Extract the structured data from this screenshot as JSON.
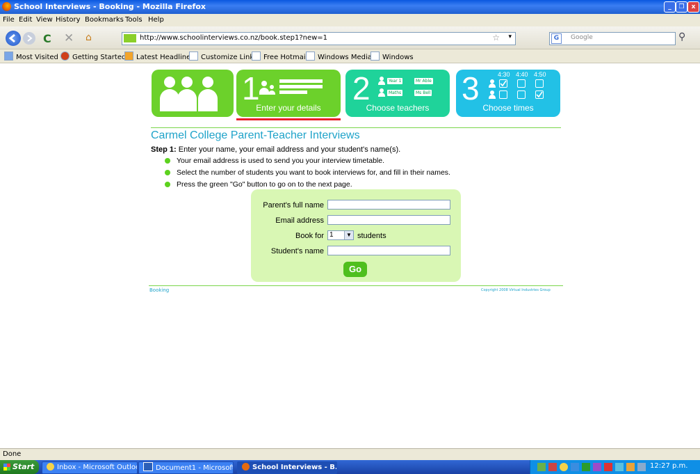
{
  "window": {
    "title": "School Interviews - Booking - Mozilla Firefox",
    "controls": {
      "minimize": "_",
      "restore": "❐",
      "close": "x"
    }
  },
  "menu": [
    "File",
    "Edit",
    "View",
    "History",
    "Bookmarks",
    "Tools",
    "Help"
  ],
  "nav": {
    "url": "http://www.schoolinterviews.co.nz/book.step1?new=1",
    "search_placeholder": "Google"
  },
  "bookmarks": [
    "Most Visited",
    "Getting Started",
    "Latest Headlines",
    "Customize Links",
    "Free Hotmail",
    "Windows Media",
    "Windows"
  ],
  "steps": [
    {
      "number": "1",
      "label": "Enter your details"
    },
    {
      "number": "2",
      "label": "Choose teachers",
      "selects": [
        "Year 1",
        "Mr Able",
        "Maths",
        "Ms Bell"
      ]
    },
    {
      "number": "3",
      "label": "Choose times",
      "times": [
        "4:30",
        "4:40",
        "4:50"
      ]
    }
  ],
  "page": {
    "title": "Carmel College Parent-Teacher Interviews",
    "step_prefix": "Step 1:",
    "step_text": " Enter your name, your email address and your student's name(s).",
    "bullets": [
      "Your email address is used to send you your interview timetable.",
      "Select the number of students you want to book interviews for, and fill in their names.",
      "Press the green \"Go\" button to go on to the next page."
    ]
  },
  "form": {
    "parent_label": "Parent's full name",
    "email_label": "Email address",
    "book_for_label": "Book for",
    "book_for_value": "1",
    "students_suffix": "students",
    "student_label": "Student's name",
    "go_label": "Go"
  },
  "footer": {
    "left": "Booking",
    "right": "Copyright 2008 Virtual Industries Group"
  },
  "status": "Done",
  "taskbar": {
    "start": "Start",
    "tasks": [
      "Inbox - Microsoft Outlook",
      "Document1 - Microsoft ...",
      "School Interviews - B..."
    ],
    "clock": "12:27 p.m."
  },
  "colors": {
    "green": "#6cd12b",
    "teal": "#1fd39a",
    "blue": "#22c1e6",
    "accent_red": "#e8202a",
    "title_blue": "#1fa3c9"
  }
}
